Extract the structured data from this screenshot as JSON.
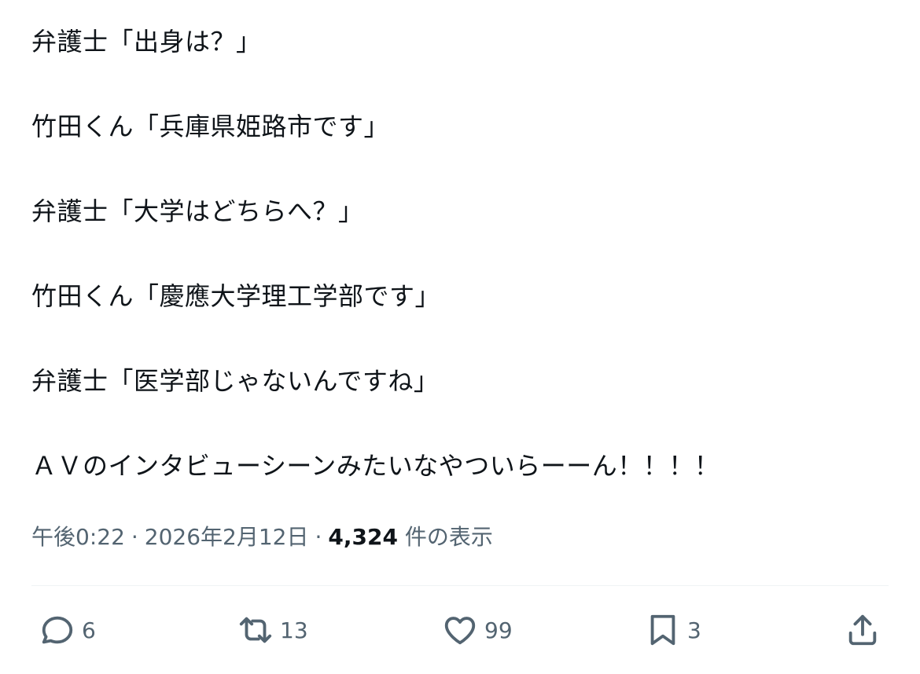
{
  "tweet": {
    "lines": [
      "弁護士「出身は？」",
      "",
      "竹田くん「兵庫県姫路市です」",
      "",
      "弁護士「大学はどちらへ？」",
      "",
      "竹田くん「慶應大学理工学部です」",
      "",
      "弁護士「医学部じゃないんですね」",
      "",
      "ＡＶのインタビューシーンみたいなやついらーーん！！！！"
    ],
    "time": "午後0:22",
    "date": "2026年2月12日",
    "views_count": "4,324",
    "views_label": "件の表示",
    "separator": "·"
  },
  "actions": {
    "reply_count": "6",
    "retweet_count": "13",
    "like_count": "99",
    "bookmark_count": "3"
  },
  "colors": {
    "text": "#0f1419",
    "secondary": "#536471",
    "divider": "#eff3f4"
  }
}
